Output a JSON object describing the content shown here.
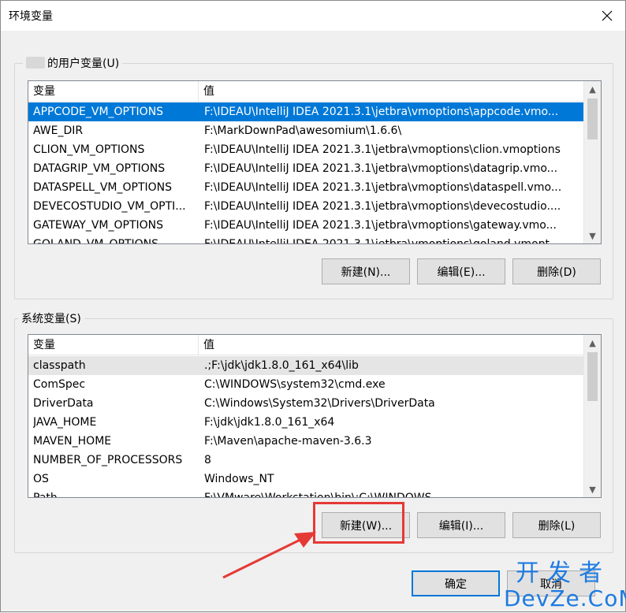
{
  "window": {
    "title": "环境变量",
    "close_icon": "close-icon"
  },
  "user_vars": {
    "group_label": "的用户变量(U)",
    "columns": [
      "变量",
      "值"
    ],
    "rows": [
      {
        "name": "APPCODE_VM_OPTIONS",
        "value": "F:\\IDEAU\\IntelliJ IDEA 2021.3.1\\jetbra\\vmoptions\\appcode.vmo..."
      },
      {
        "name": "AWE_DIR",
        "value": "F:\\MarkDownPad\\awesomium\\1.6.6\\"
      },
      {
        "name": "CLION_VM_OPTIONS",
        "value": "F:\\IDEAU\\IntelliJ IDEA 2021.3.1\\jetbra\\vmoptions\\clion.vmoptions"
      },
      {
        "name": "DATAGRIP_VM_OPTIONS",
        "value": "F:\\IDEAU\\IntelliJ IDEA 2021.3.1\\jetbra\\vmoptions\\datagrip.vmo..."
      },
      {
        "name": "DATASPELL_VM_OPTIONS",
        "value": "F:\\IDEAU\\IntelliJ IDEA 2021.3.1\\jetbra\\vmoptions\\dataspell.vmo..."
      },
      {
        "name": "DEVECOSTUDIO_VM_OPTI...",
        "value": "F:\\IDEAU\\IntelliJ IDEA 2021.3.1\\jetbra\\vmoptions\\devecostudio...."
      },
      {
        "name": "GATEWAY_VM_OPTIONS",
        "value": "F:\\IDEAU\\IntelliJ IDEA 2021.3.1\\jetbra\\vmoptions\\gateway.vmo..."
      },
      {
        "name": "GOLAND_VM_OPTIONS",
        "value": "F:\\IDEAU\\IntelliJ IDEA 2021.3.1\\jetbra\\vmoptions\\goland.vmopt..."
      }
    ],
    "buttons": {
      "new": "新建(N)...",
      "edit": "编辑(E)...",
      "delete": "删除(D)"
    }
  },
  "system_vars": {
    "group_label": "系统变量(S)",
    "columns": [
      "变量",
      "值"
    ],
    "rows": [
      {
        "name": "classpath",
        "value": ".;F:\\jdk\\jdk1.8.0_161_x64\\lib"
      },
      {
        "name": "ComSpec",
        "value": "C:\\WINDOWS\\system32\\cmd.exe"
      },
      {
        "name": "DriverData",
        "value": "C:\\Windows\\System32\\Drivers\\DriverData"
      },
      {
        "name": "JAVA_HOME",
        "value": "F:\\jdk\\jdk1.8.0_161_x64"
      },
      {
        "name": "MAVEN_HOME",
        "value": "F:\\Maven\\apache-maven-3.6.3"
      },
      {
        "name": "NUMBER_OF_PROCESSORS",
        "value": "8"
      },
      {
        "name": "OS",
        "value": "Windows_NT"
      },
      {
        "name": "Path",
        "value": "F:\\VMware\\Workstation\\bin\\;C:\\WINDOWS..."
      }
    ],
    "buttons": {
      "new": "新建(W)...",
      "edit": "编辑(I)...",
      "delete": "删除(L)"
    }
  },
  "footer": {
    "ok": "确定",
    "cancel": "取消"
  },
  "watermark": {
    "cn": "开发者",
    "en": "DevZe.CoM"
  },
  "colors": {
    "selection": "#0078d7",
    "annotation": "#e53935",
    "watermark": "#1e7be0"
  }
}
